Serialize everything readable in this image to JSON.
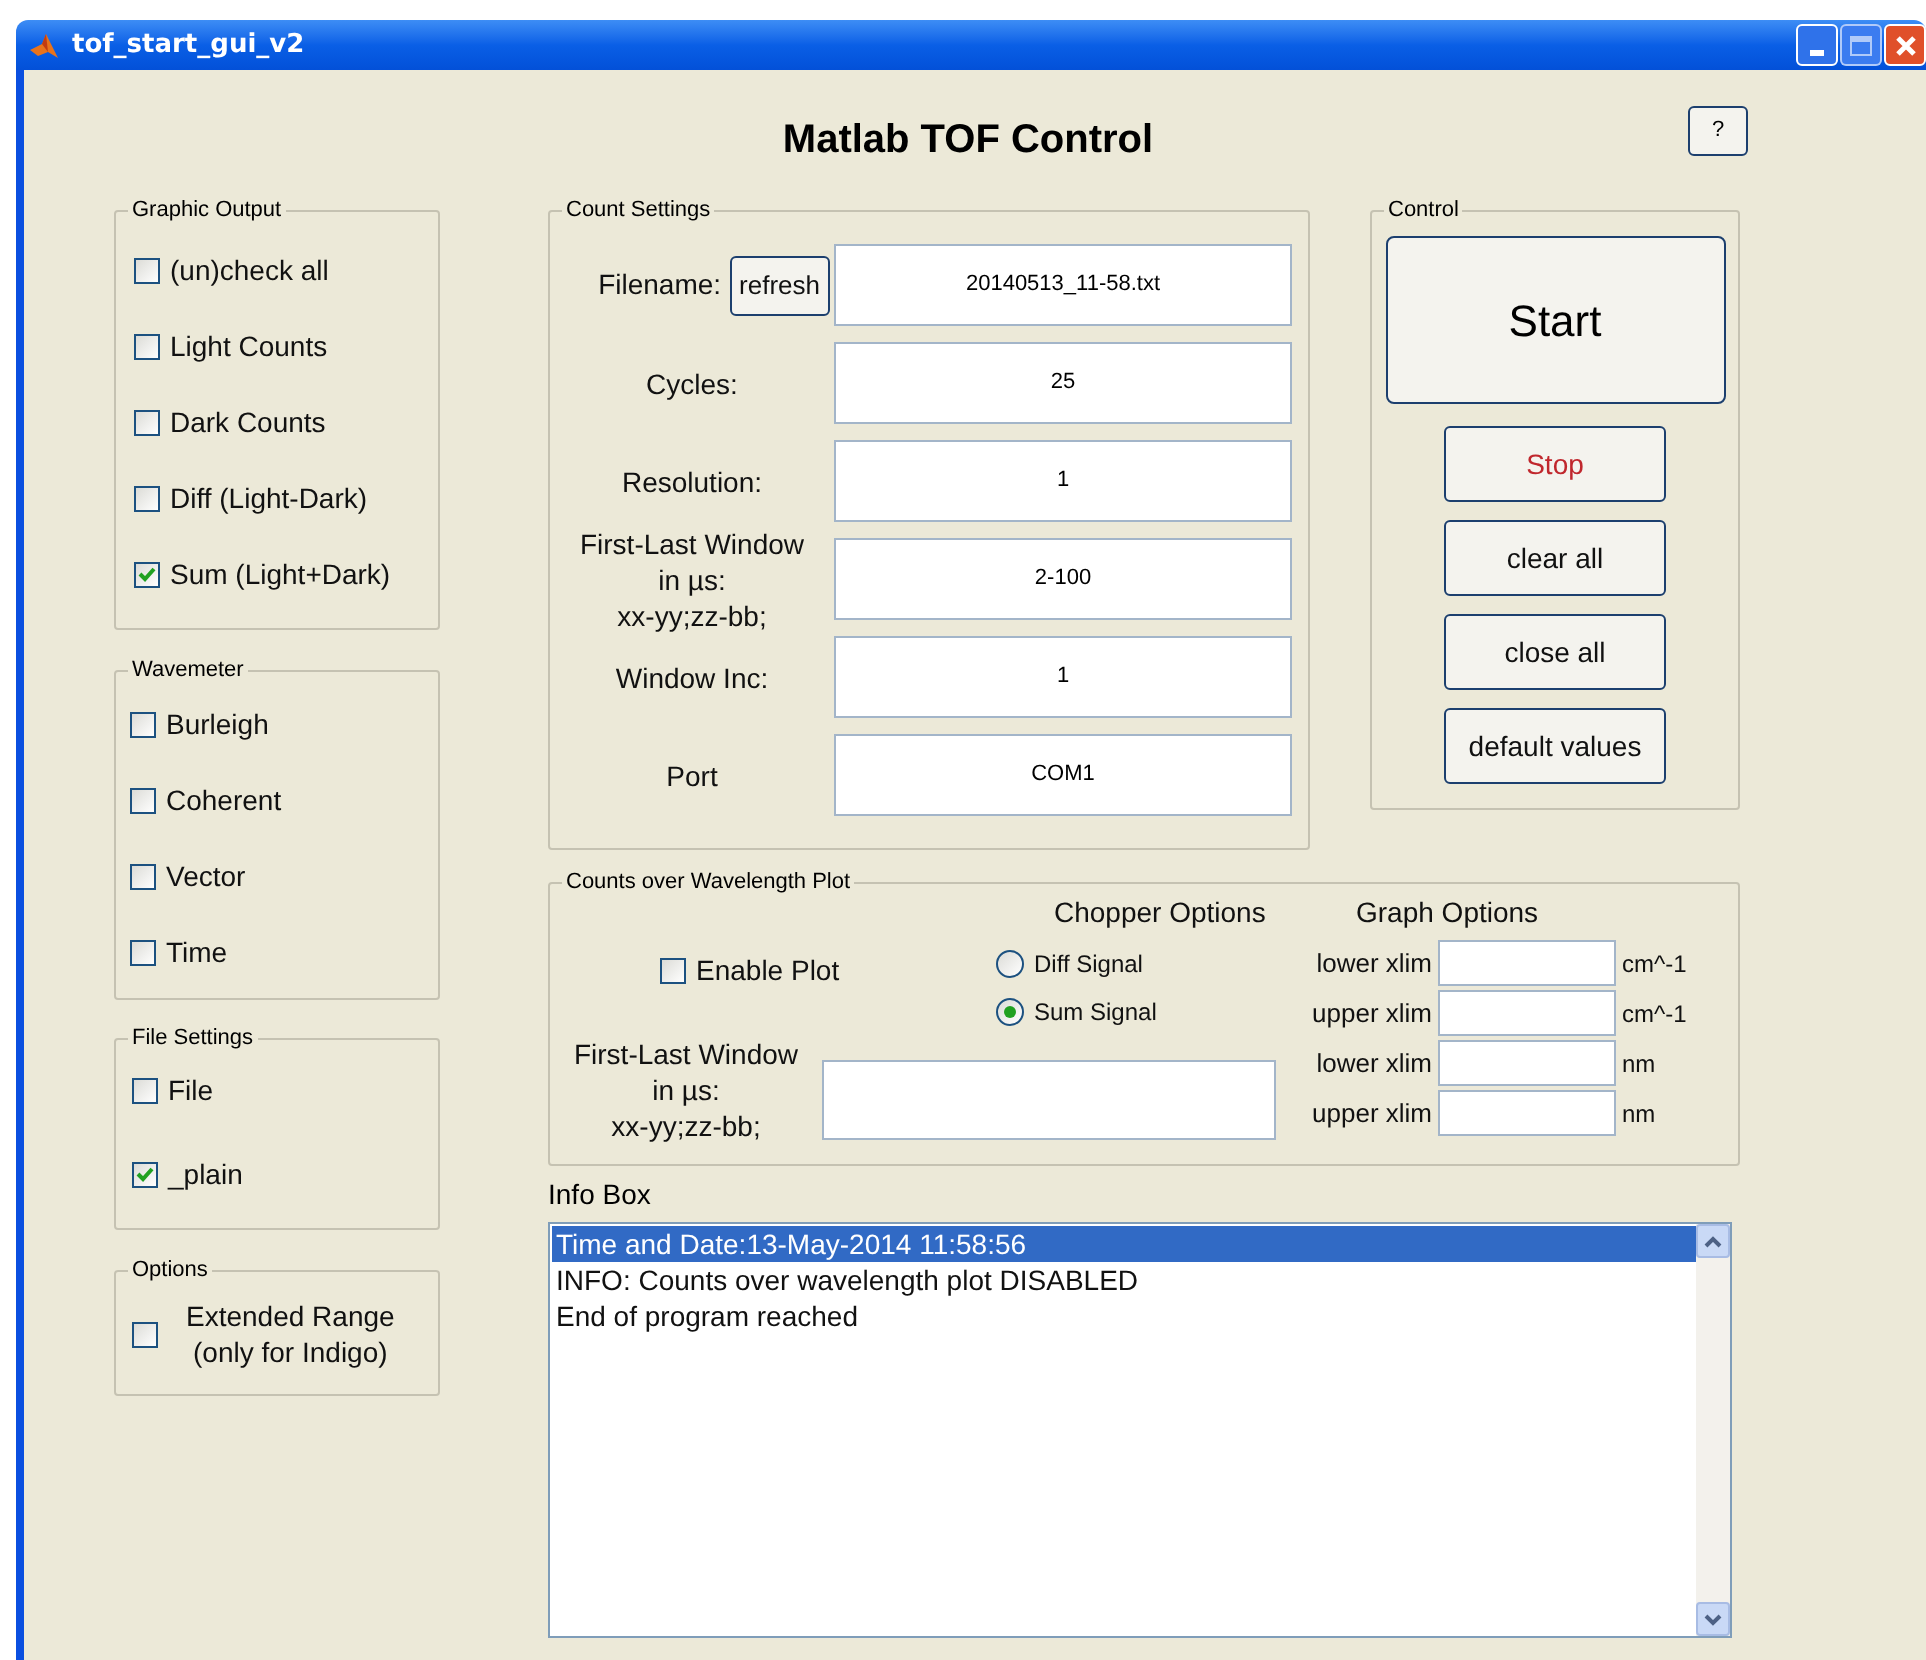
{
  "window": {
    "title": "tof_start_gui_v2"
  },
  "heading": "Matlab TOF Control",
  "help_button": "?",
  "graphic_output": {
    "title": "Graphic Output",
    "items": [
      {
        "label": "(un)check all",
        "checked": false
      },
      {
        "label": "Light Counts",
        "checked": false
      },
      {
        "label": "Dark Counts",
        "checked": false
      },
      {
        "label": "Diff (Light-Dark)",
        "checked": false
      },
      {
        "label": "Sum (Light+Dark)",
        "checked": true
      }
    ]
  },
  "wavemeter": {
    "title": "Wavemeter",
    "items": [
      {
        "label": "Burleigh",
        "checked": false
      },
      {
        "label": "Coherent",
        "checked": false
      },
      {
        "label": "Vector",
        "checked": false
      },
      {
        "label": "Time",
        "checked": false
      }
    ]
  },
  "file_settings": {
    "title": "File Settings",
    "items": [
      {
        "label": "File",
        "checked": false
      },
      {
        "label": "_plain",
        "checked": true
      }
    ]
  },
  "options": {
    "title": "Options",
    "items": [
      {
        "label": "Extended Range\n(only for Indigo)",
        "checked": false
      }
    ]
  },
  "count_settings": {
    "title": "Count Settings",
    "rows": [
      {
        "label": "Filename:",
        "button": "refresh",
        "value": "20140513_11-58.txt"
      },
      {
        "label": "Cycles:",
        "value": "25"
      },
      {
        "label": "Resolution:",
        "value": "1"
      },
      {
        "label": "First-Last Window\nin µs:\nxx-yy;zz-bb;",
        "value": "2-100"
      },
      {
        "label": "Window Inc:",
        "value": "1"
      },
      {
        "label": "Port",
        "value": "COM1"
      }
    ]
  },
  "control": {
    "title": "Control",
    "start_button": "Start",
    "buttons": [
      {
        "label": "Stop",
        "kind": "danger"
      },
      {
        "label": "clear all",
        "kind": "normal"
      },
      {
        "label": "close all",
        "kind": "normal"
      },
      {
        "label": "default values",
        "kind": "normal"
      }
    ]
  },
  "wavelength_plot": {
    "title": "Counts over Wavelength Plot",
    "enable_plot": {
      "label": "Enable Plot",
      "checked": false
    },
    "chopper_options": {
      "title": "Chopper Options",
      "options": [
        {
          "label": "Diff Signal",
          "selected": false
        },
        {
          "label": "Sum Signal",
          "selected": true
        }
      ]
    },
    "window_field": {
      "label": "First-Last Window\nin µs:\nxx-yy;zz-bb;"
    },
    "graph_options": {
      "title": "Graph Options",
      "rows": [
        {
          "label": "lower xlim",
          "unit": "cm^-1"
        },
        {
          "label": "upper xlim",
          "unit": "cm^-1"
        },
        {
          "label": "lower xlim",
          "unit": "nm"
        },
        {
          "label": "upper xlim",
          "unit": "nm"
        }
      ]
    }
  },
  "info_box": {
    "label": "Info Box",
    "lines": [
      {
        "text": "Time and Date:13-May-2014 11:58:56",
        "selected": true
      },
      {
        "text": "INFO: Counts over wavelength plot DISABLED",
        "selected": false
      },
      {
        "text": "End of program reached",
        "selected": false
      }
    ]
  }
}
